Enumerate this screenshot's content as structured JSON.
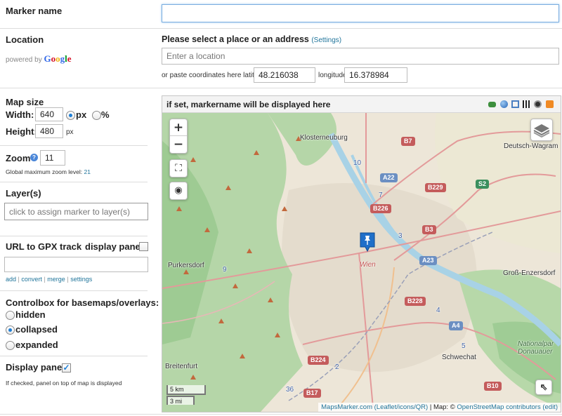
{
  "marker_name": {
    "label": "Marker name",
    "value": ""
  },
  "location": {
    "label": "Location",
    "powered_by": "powered by",
    "google": {
      "G": "G",
      "o1": "o",
      "o2": "o",
      "g": "g",
      "l": "l",
      "e": "e"
    },
    "prompt": "Please select a place or an address",
    "settings_link": "(Settings)",
    "placeholder": "Enter a location",
    "coords_label": "or paste coordinates here latitude:",
    "latitude": "48.216038",
    "longitude_label": "longitude:",
    "longitude": "16.378984"
  },
  "map_size": {
    "label": "Map size",
    "width_label": "Width:",
    "width_value": "640",
    "unit_px": "px",
    "unit_pct": "%",
    "width_unit_selected": "px",
    "height_label": "Height:",
    "height_value": "480",
    "height_unit": "px"
  },
  "zoom": {
    "label": "Zoom",
    "help_icon": "question-circle-icon",
    "value": "11",
    "global_max_text": "Global maximum zoom level:",
    "global_max_value": "21"
  },
  "layers": {
    "label": "Layer(s)",
    "placeholder": "click to assign marker to layer(s)"
  },
  "gpx": {
    "label": "URL to GPX track",
    "display_panel_label": "display panel",
    "display_panel_checked": false,
    "value": "",
    "links": {
      "add": "add",
      "sep1": "|",
      "convert": "convert",
      "sep2": "|",
      "merge": "merge",
      "sep3": "|",
      "settings": "settings"
    }
  },
  "controlbox": {
    "label": "Controlbox for basemaps/overlays:",
    "options": [
      {
        "label": "hidden",
        "checked": false
      },
      {
        "label": "collapsed",
        "checked": true
      },
      {
        "label": "expanded",
        "checked": false
      }
    ]
  },
  "display_panel": {
    "label": "Display panel",
    "checked": true,
    "check_mark": "✓",
    "note": "If checked, panel on top of map is displayed"
  },
  "map": {
    "header_text": "if set, markername will be displayed here",
    "header_icons": [
      "car-icon",
      "globe-icon",
      "fullscreen-icon",
      "qr-code-icon",
      "kml-icon",
      "rss-icon"
    ],
    "zoom_in": "+",
    "zoom_out": "−",
    "fullscreen_symbol": "⛶",
    "locate_symbol": "◉",
    "labels": {
      "klosterneuburg": "Klosterneuburg",
      "deutsch_wagram": "Deutsch-Wagram",
      "purkersdorf": "Purkersdorf",
      "wien": "Wien",
      "gross_enzersdorf": "Groß-Enzersdorf",
      "breitenfurt": "Breitenfurt",
      "schwechat": "Schwechat",
      "nationalpark_1": "Nationalpar",
      "nationalpark_2": "Donauauer"
    },
    "shields": {
      "b7": "B7",
      "a22": "A22",
      "b229": "B229",
      "b226": "B226",
      "s2": "S2",
      "b3": "B3",
      "a23": "A23",
      "b228": "B228",
      "a4": "A4",
      "b224": "B224",
      "b17": "B17",
      "b10": "B10"
    },
    "route_numbers": {
      "r10": "10",
      "r7": "7",
      "r3": "3",
      "r9": "9",
      "r4": "4",
      "r5": "5",
      "r2": "2",
      "r36": "36"
    },
    "scale_km": "5 km",
    "scale_mi": "3 mi",
    "attribution": {
      "mapsmarker": "MapsMarker.com",
      "leaflet_group": "(Leaflet/icons/QR)",
      "sep": "| Map: ©",
      "osm": "OpenStreetMap contributors",
      "edit": "(edit)"
    },
    "colors": {
      "water": "#a8d2e6",
      "forest": "#9bc99a",
      "road_red": "#e39a9a",
      "marker": "#1f6fc9"
    }
  }
}
